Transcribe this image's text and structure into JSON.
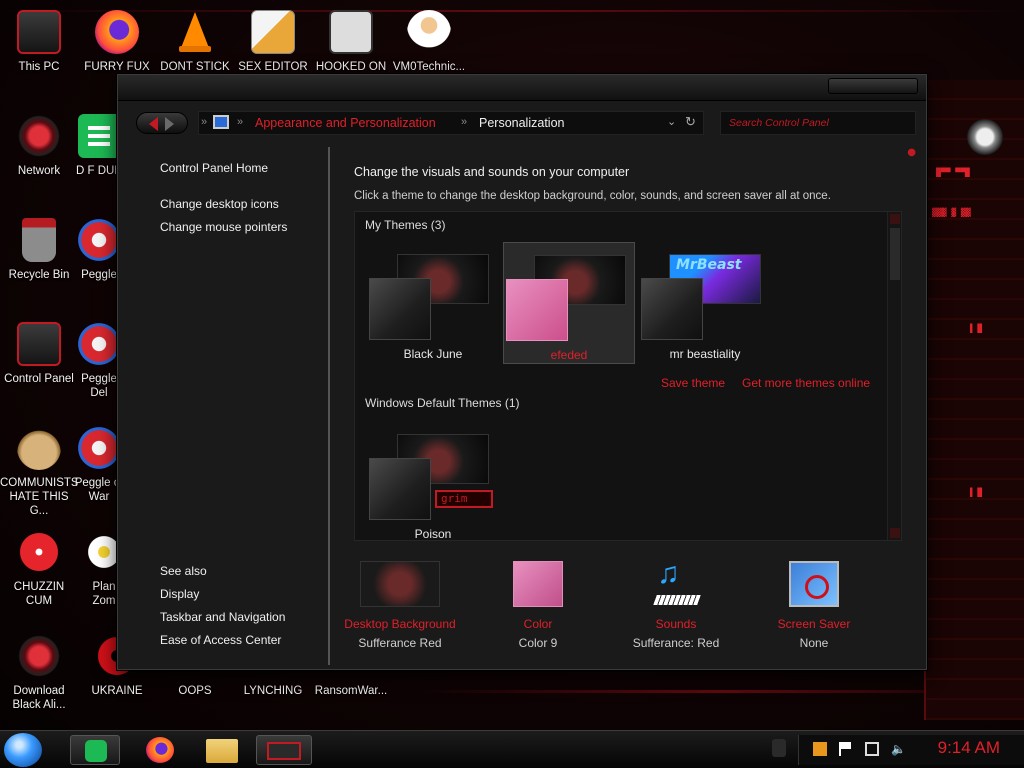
{
  "desktop": {
    "icons": [
      {
        "label": "This PC",
        "icon": "this-pc-icon"
      },
      {
        "label": "FURRY FUX",
        "icon": "firefox-icon"
      },
      {
        "label": "DONT STICK",
        "icon": "vlc-cone-icon"
      },
      {
        "label": "SEX EDITOR",
        "icon": "hxd-icon"
      },
      {
        "label": "HOOKED ON",
        "icon": "hooked-on-icon"
      },
      {
        "label": "VM0Technic...",
        "icon": "doctor-icon"
      },
      {
        "label": "Network",
        "icon": "network-icon"
      },
      {
        "label": "D F DUM",
        "icon": "notes-icon"
      },
      {
        "label": "Recycle Bin",
        "icon": "recycle-bin-icon"
      },
      {
        "label": "Peggle",
        "icon": "peggle-icon"
      },
      {
        "label": "Control Panel",
        "icon": "control-panel-icon"
      },
      {
        "label": "Peggle Del",
        "icon": "peggle-icon"
      },
      {
        "label": "COMMUNISTS HATE THIS G...",
        "icon": "money-bag-icon"
      },
      {
        "label": "Peggle of War",
        "icon": "peggle-icon"
      },
      {
        "label": "CHUZZIN CUM",
        "icon": "chuzzle-icon"
      },
      {
        "label": "Plan Zom",
        "icon": "flower-icon"
      },
      {
        "label": "Download Black Ali...",
        "icon": "alien-download-icon"
      },
      {
        "label": "UKRAINE",
        "icon": "ukraine-icon"
      },
      {
        "label": "OOPS",
        "icon": "blank-icon"
      },
      {
        "label": "LYNCHING",
        "icon": "blank-icon"
      },
      {
        "label": "RansomWar...",
        "icon": "blank-icon"
      }
    ]
  },
  "window": {
    "address": {
      "crumb1": "Appearance and Personalization",
      "crumb2": "Personalization",
      "separator": "»"
    },
    "search_placeholder": "Search Control Panel",
    "sidebar": {
      "home": "Control Panel Home",
      "links": [
        "Change desktop icons",
        "Change mouse pointers"
      ],
      "see_also_title": "See also",
      "see_also": [
        "Display",
        "Taskbar and Navigation",
        "Ease of Access Center"
      ]
    },
    "main": {
      "title": "Change the visuals and sounds on your computer",
      "subtitle": "Click a theme to change the desktop background, color, sounds, and screen saver all at once.",
      "my_themes_heading": "My Themes (3)",
      "my_themes": [
        {
          "name": "Black June",
          "selected": false
        },
        {
          "name": "efeded",
          "selected": true
        },
        {
          "name": "mr beastiality",
          "selected": false
        }
      ],
      "save_theme": "Save theme",
      "get_more": "Get more themes online",
      "default_heading": "Windows Default Themes (1)",
      "default_themes": [
        {
          "name": "Poison",
          "badge": "grim"
        }
      ],
      "thumb_text": {
        "beast": "MrBeast"
      },
      "settings": [
        {
          "name": "Desktop Background",
          "value": "Sufferance Red"
        },
        {
          "name": "Color",
          "value": "Color 9"
        },
        {
          "name": "Sounds",
          "value": "Sufferance: Red"
        },
        {
          "name": "Screen Saver",
          "value": "None"
        }
      ]
    }
  },
  "taskbar": {
    "clock": "9:14 AM"
  },
  "colors": {
    "accent": "#e0202a",
    "swatch_pink": "#e08fb8"
  }
}
